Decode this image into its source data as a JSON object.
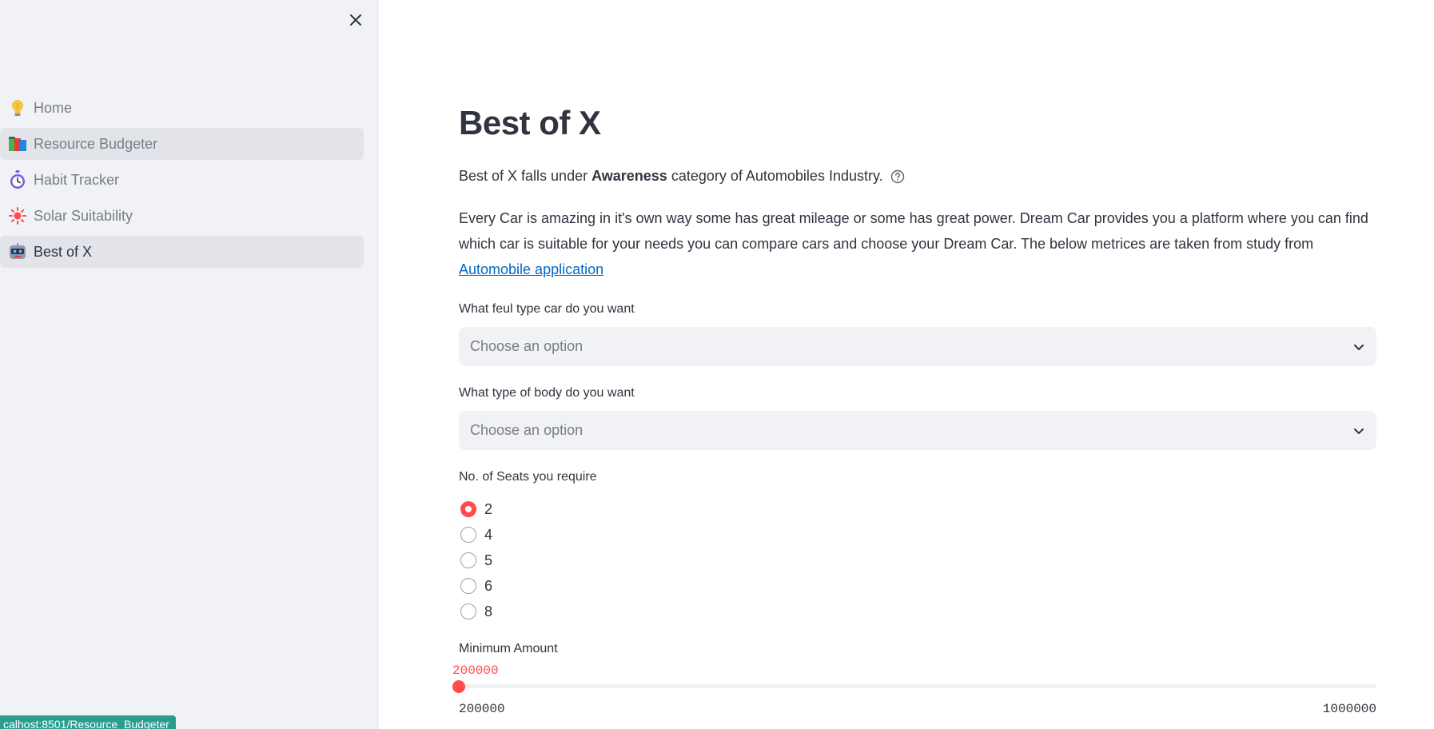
{
  "sidebar": {
    "items": [
      {
        "label": "Home",
        "icon": "lightbulb-icon"
      },
      {
        "label": "Resource Budgeter",
        "icon": "books-icon"
      },
      {
        "label": "Habit Tracker",
        "icon": "stopwatch-icon"
      },
      {
        "label": "Solar Suitability",
        "icon": "sun-icon"
      },
      {
        "label": "Best of X",
        "icon": "robot-icon"
      }
    ],
    "active": "Best of X",
    "status_url": "calhost:8501/Resource_Budgeter"
  },
  "main": {
    "title": "Best of X",
    "category_prefix": "Best of X falls under",
    "category_bold": "Awareness",
    "category_suffix": "category of Automobiles Industry.",
    "description": "Every Car is amazing in it's own way some has great mileage or some has great power. Dream Car provides you a platform where you can find which car is suitable for your needs you can compare cars and choose your Dream Car. The below metrices are taken from study from",
    "link_text": "Automobile application",
    "fuel_label": "What feul type car do you want",
    "fuel_placeholder": "Choose an option",
    "body_label": "What type of body do you want",
    "body_placeholder": "Choose an option",
    "seats_label": "No. of Seats you require",
    "seats_options": [
      "2",
      "4",
      "5",
      "6",
      "8"
    ],
    "seats_selected": "2",
    "amount_label": "Minimum Amount",
    "amount_value": "200000",
    "amount_min": "200000",
    "amount_max": "1000000"
  },
  "colors": {
    "primary": "#ff4b4b",
    "sidebar_bg": "#f0f2f6",
    "link": "#0068c9",
    "text": "#31333f"
  }
}
